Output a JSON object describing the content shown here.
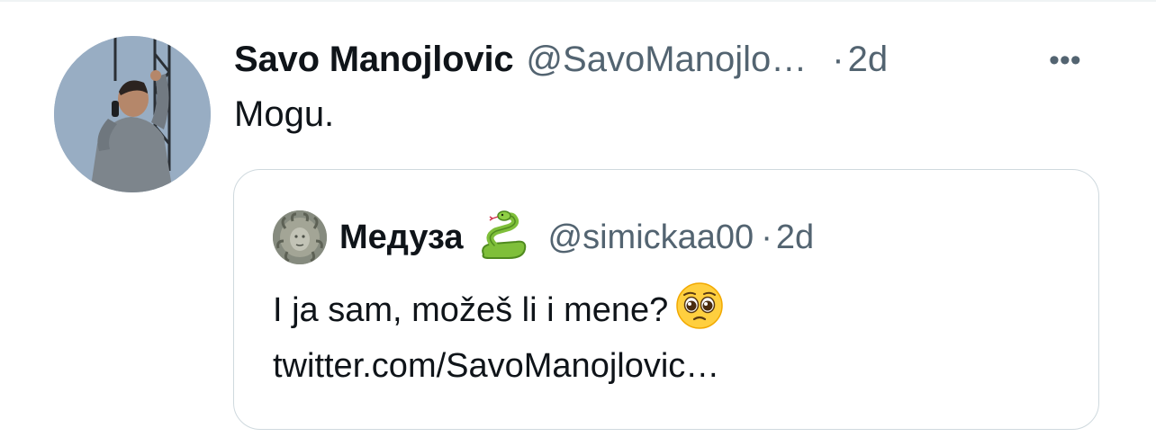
{
  "tweet": {
    "author_name": "Savo Manojlovic",
    "author_handle": "@SavoManojlo…",
    "separator": "·",
    "time": "2d",
    "more_label": "•••",
    "text": "Mogu."
  },
  "quoted_tweet": {
    "author_name": "Медуза",
    "author_emoji": "snake-emoji",
    "author_handle": "@simickaa00",
    "separator": "·",
    "time": "2d",
    "text_line1": "I ja sam, možeš li i mene?",
    "text_emoji": "pleading-face-emoji",
    "text_line2": "twitter.com/SavoManojlovic…"
  },
  "colors": {
    "text_primary": "#0f1419",
    "text_secondary": "#536471",
    "border": "#cfd9de"
  }
}
